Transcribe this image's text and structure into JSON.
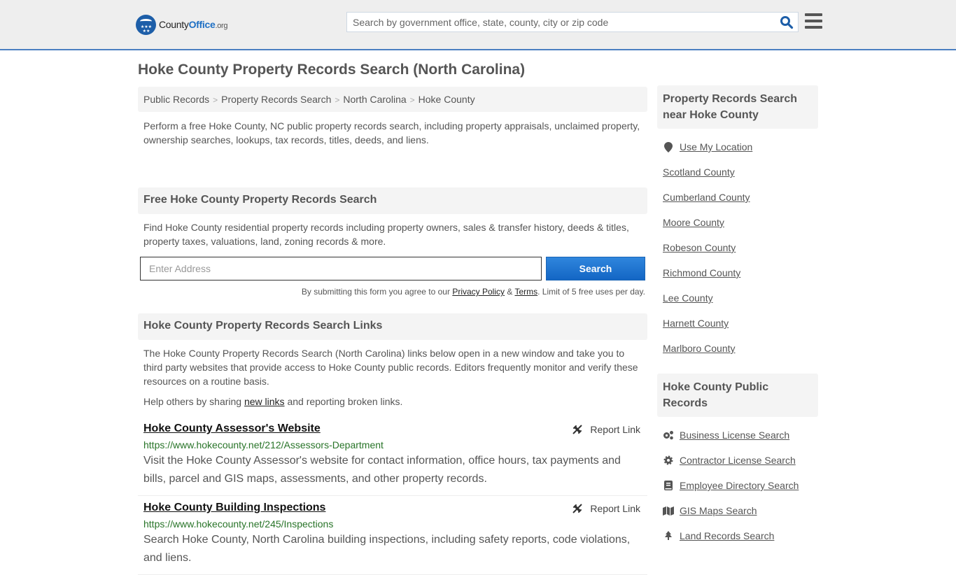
{
  "header": {
    "logo": {
      "county": "County",
      "office": "Office",
      "org": ".org"
    },
    "search_placeholder": "Search by government office, state, county, city or zip code",
    "accent_color": "#1d6fc4"
  },
  "page_title": "Hoke County Property Records Search (North Carolina)",
  "breadcrumb": [
    "Public Records",
    "Property Records Search",
    "North Carolina",
    "Hoke County"
  ],
  "intro": "Perform a free Hoke County, NC public property records search, including property appraisals, unclaimed property, ownership searches, lookups, tax records, titles, deeds, and liens.",
  "free_search": {
    "heading": "Free Hoke County Property Records Search",
    "text": "Find Hoke County residential property records including property owners, sales & transfer history, deeds & titles, property taxes, valuations, land, zoning records & more.",
    "address_placeholder": "Enter Address",
    "button": "Search",
    "disclaimer_pre": "By submitting this form you agree to our ",
    "privacy": "Privacy Policy",
    "amp": " & ",
    "terms": "Terms",
    "disclaimer_post": ". Limit of 5 free uses per day."
  },
  "links_section": {
    "heading": "Hoke County Property Records Search Links",
    "text": "The Hoke County Property Records Search (North Carolina) links below open in a new window and take you to third party websites that provide access to Hoke County public records. Editors frequently monitor and verify these resources on a routine basis.",
    "help_pre": "Help others by sharing ",
    "help_link": "new links",
    "help_post": " and reporting broken links.",
    "report_label": "Report Link",
    "items": [
      {
        "title": "Hoke County Assessor's Website",
        "url": "https://www.hokecounty.net/212/Assessors-Department",
        "desc": "Visit the Hoke County Assessor's website for contact information, office hours, tax payments and bills, parcel and GIS maps, assessments, and other property records."
      },
      {
        "title": "Hoke County Building Inspections",
        "url": "https://www.hokecounty.net/245/Inspections",
        "desc": "Search Hoke County, North Carolina building inspections, including safety reports, code violations, and liens."
      }
    ]
  },
  "sidebar": {
    "nearby_heading": "Property Records Search near Hoke County",
    "use_location": "Use My Location",
    "nearby": [
      "Scotland County",
      "Cumberland County",
      "Moore County",
      "Robeson County",
      "Richmond County",
      "Lee County",
      "Harnett County",
      "Marlboro County"
    ],
    "public_heading": "Hoke County Public Records",
    "public_records": [
      {
        "label": "Business License Search",
        "icon": "gears-icon"
      },
      {
        "label": "Contractor License Search",
        "icon": "gear-icon"
      },
      {
        "label": "Employee Directory Search",
        "icon": "book-icon"
      },
      {
        "label": "GIS Maps Search",
        "icon": "map-icon"
      },
      {
        "label": "Land Records Search",
        "icon": "tree-icon"
      }
    ]
  }
}
